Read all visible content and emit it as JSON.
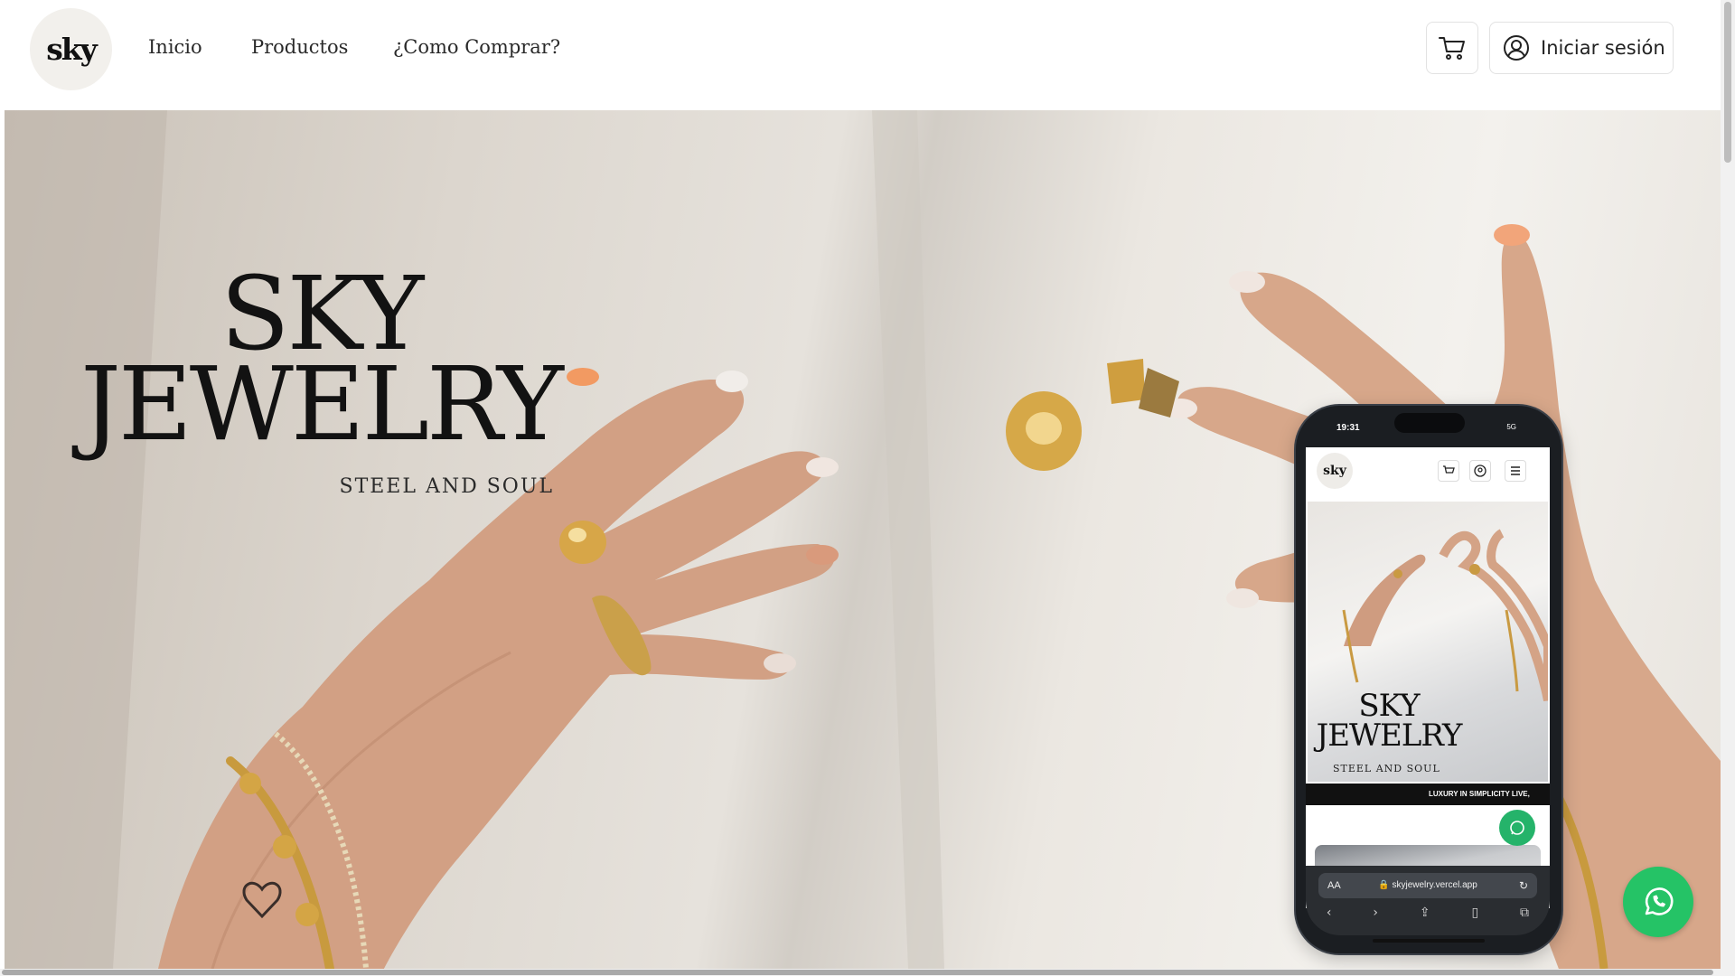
{
  "header": {
    "logo_text": "sky",
    "nav": [
      {
        "label": "Inicio"
      },
      {
        "label": "Productos"
      },
      {
        "label": "¿Como Comprar?"
      }
    ],
    "cart_icon": "cart-icon",
    "login_icon": "user-circle-icon",
    "login_label": "Iniciar sesión"
  },
  "hero": {
    "title_line1": "SKY",
    "title_line2": "JEWELRY",
    "tagline": "STEEL AND SOUL"
  },
  "phone": {
    "time": "19:31",
    "signal": "5G",
    "logo_text": "sky",
    "title_line1": "SKY",
    "title_line2": "JEWELRY",
    "tagline": "STEEL AND SOUL",
    "marquee": "LUXURY IN SIMPLICITY          LIVE,",
    "url_aa": "AA",
    "url": "skyjewelry.vercel.app"
  },
  "whatsapp_icon": "whatsapp-icon",
  "colors": {
    "whatsapp_green": "#25c366",
    "ring_gold": "#c89a3e",
    "text_dark": "#121212"
  }
}
